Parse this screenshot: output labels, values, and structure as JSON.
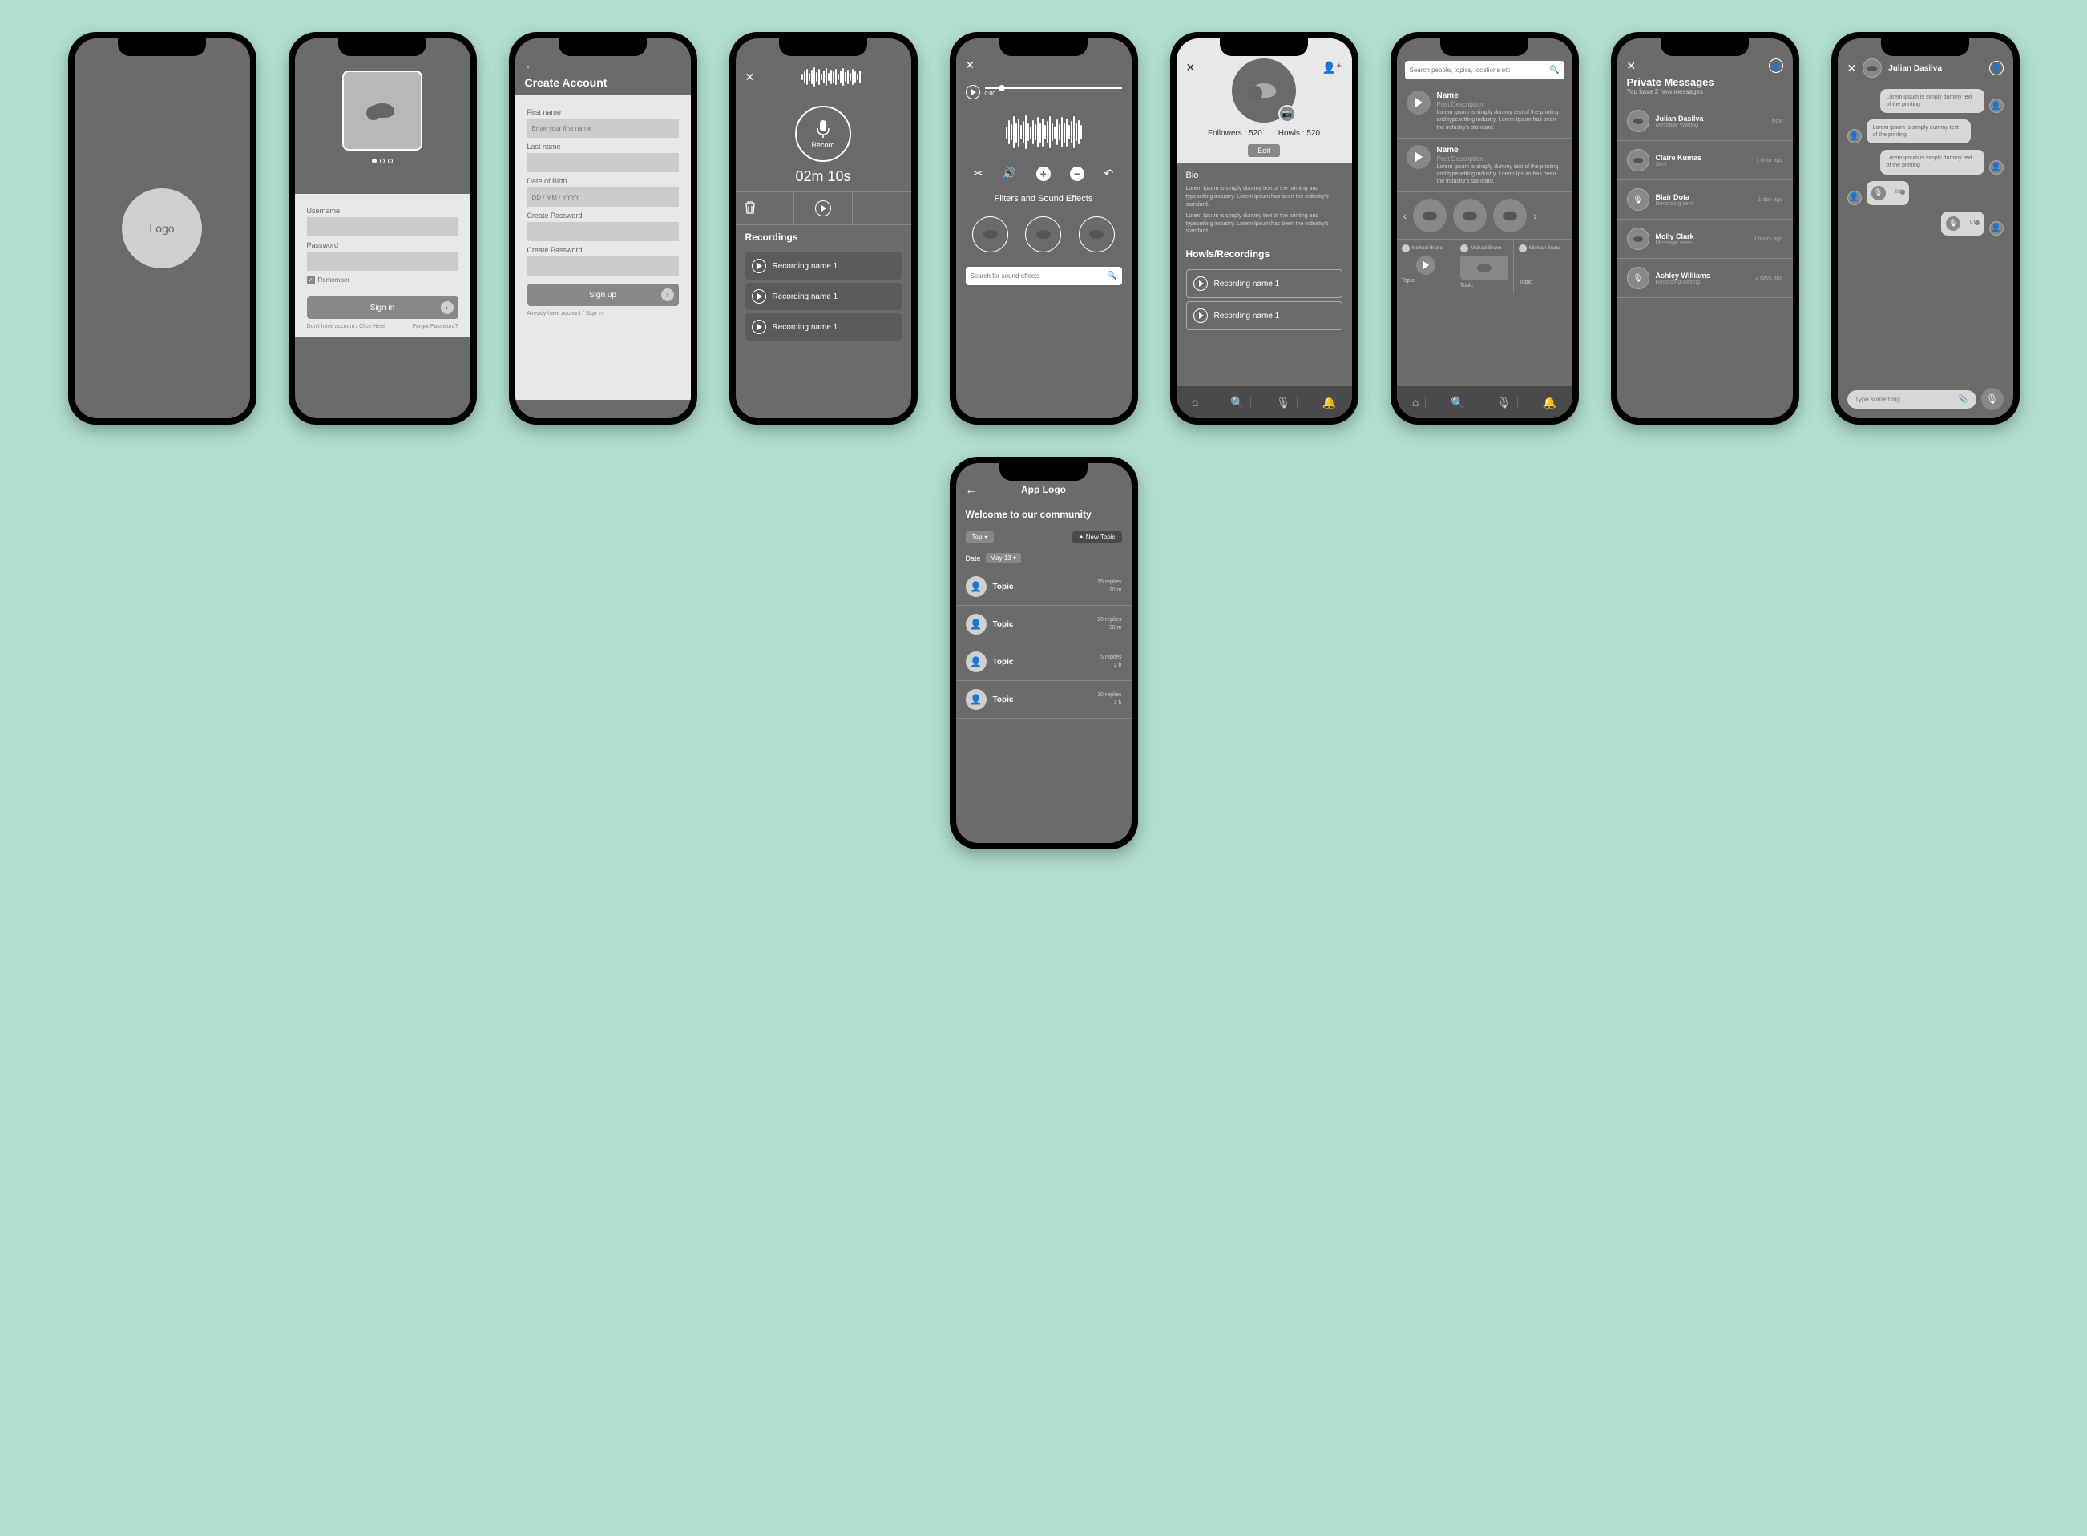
{
  "splash": {
    "logo_text": "Logo"
  },
  "signin": {
    "username_label": "Username",
    "password_label": "Password",
    "remember_label": "Remember",
    "button": "Sign in",
    "no_account": "Don't have account / Click Here",
    "forgot": "Forgot Password?"
  },
  "signup": {
    "title": "Create Account",
    "first_name_label": "First name",
    "first_name_placeholder": "Enter your first name",
    "last_name_label": "Last name",
    "dob_label": "Date of Birth",
    "dob_placeholder": "DD / MM / YYYY",
    "create_pw_label": "Create Password",
    "confirm_pw_label": "Create Password",
    "button": "Sign up",
    "already": "Already have account / Sign in"
  },
  "record": {
    "button_label": "Record",
    "timer": "02m 10s",
    "section": "Recordings",
    "items": [
      "Recording name 1",
      "Recording name 1",
      "Recording name 1"
    ]
  },
  "editor": {
    "time_label": "0:00",
    "filters_title": "Filters and Sound Effects",
    "search_placeholder": "Search for sound effects"
  },
  "profile": {
    "followers_label": "Followers : 520",
    "howls_label": "Howls : 520",
    "edit": "Edit",
    "bio_title": "Bio",
    "bio_p1": "Lorem Ipsum is simply dummy text of the printing and typesetting industry. Lorem Ipsum has been the industry's standard.",
    "bio_p2": "Lorem Ipsum is simply dummy text of the printing and typesetting industry. Lorem Ipsum has been the industry's standard.",
    "rec_title": "Howls/Recordings",
    "rec_items": [
      "Recording name 1",
      "Recording name 1"
    ]
  },
  "feed": {
    "search_placeholder": "Search people, topics, locations etc",
    "posts": [
      {
        "name": "Name",
        "sub": "Post Description",
        "desc": "Lorem Ipsum is simply dummy text of the printing and typesetting industry. Lorem Ipsum has been the industry's standard."
      },
      {
        "name": "Name",
        "sub": "Post Description",
        "desc": "Lorem Ipsum is simply dummy text of the printing and typesetting industry. Lorem Ipsum has been the industry's standard."
      }
    ],
    "grid_user": "Michael Bruno",
    "grid_topic": "Topic"
  },
  "messages": {
    "title": "Private Messages",
    "subtitle": "You have 2 new messages",
    "items": [
      {
        "name": "Julian Dasilva",
        "status": "Message Waiting",
        "time": "Now",
        "icon": "cloud"
      },
      {
        "name": "Claire Kumas",
        "status": "Sent",
        "time": "1 hour ago",
        "icon": "cloud"
      },
      {
        "name": "Blair Dota",
        "status": "Recording sent",
        "time": "1 day ago",
        "icon": "mic"
      },
      {
        "name": "Molly Clark",
        "status": "Message seen",
        "time": "5 hours ago",
        "icon": "cloud"
      },
      {
        "name": "Ashley Williams",
        "status": "Recording waiting",
        "time": "2 days ago",
        "icon": "mic"
      }
    ]
  },
  "chat": {
    "contact": "Julian Dasilva",
    "bubbles": [
      {
        "text": "Lorem ipsum is simply dummy text of the printing"
      },
      {
        "text": "Lorem ipsum is simply dummy text of the printing"
      },
      {
        "text": "Lorem ipsum is simply dummy text of the printing"
      }
    ],
    "voice_time": "0:00",
    "input_placeholder": "Type something"
  },
  "community": {
    "app_name": "App Logo",
    "welcome": "Welcome to our community",
    "filter": "Top",
    "new_topic": "New Topic",
    "date_label": "Date",
    "date_value": "May 13",
    "topics": [
      {
        "name": "Topic",
        "replies": "15 replies",
        "time": "20 m"
      },
      {
        "name": "Topic",
        "replies": "20 replies",
        "time": "30 m"
      },
      {
        "name": "Topic",
        "replies": "5 replies",
        "time": "2 h"
      },
      {
        "name": "Topic",
        "replies": "10 replies",
        "time": "3 h"
      }
    ]
  }
}
